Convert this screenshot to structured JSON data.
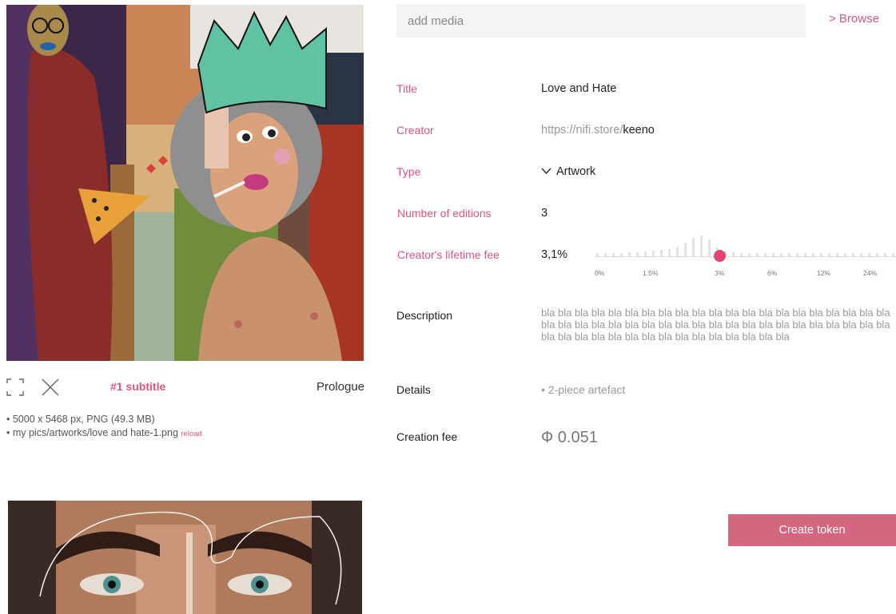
{
  "media": {
    "subtitle": "#1 subtitle",
    "prologue": "Prologue",
    "file_line1": "• 5000 x 5468 px, PNG (49.3 MB)",
    "file_line2": "• my pics/artworks/love and hate-1.png",
    "reload": "reload"
  },
  "upload": {
    "placeholder": "add media",
    "browse": "> Browse"
  },
  "form": {
    "title_label": "Title",
    "title_value": "Love and Hate",
    "creator_label": "Creator",
    "creator_prefix": "https://nifi.store/",
    "creator_value": "keeno",
    "type_label": "Type",
    "type_value": "Artwork",
    "editions_label": "Number of editions",
    "editions_value": "3",
    "fee_label": "Creator's lifetime fee",
    "fee_value": "3,1%",
    "fee_ticks": [
      "0%",
      "1.5%",
      "3%",
      "6%",
      "12%",
      "24%"
    ],
    "fee_level": 3.1,
    "description_label": "Description",
    "description_value": "bla bla bla bla bla bla bla bla bla bla bla bla bla bla bla bla bla bla bla bla bla bla bla bla bla bla bla bla bla bla bla bla bla bla bla bla bla bla bla bla bla bla bla bla bla bla bla bla bla bla bla bla bla bla bla bla bla",
    "details_label": "Details",
    "details_item": "• 2-piece artefact",
    "creation_fee_label": "Creation fee",
    "creation_fee_value": "Ф 0.051"
  },
  "actions": {
    "create": "Create token"
  },
  "colors": {
    "accent": "#d9577a",
    "button": "#d4667f",
    "slider_knob": "#e44473"
  }
}
